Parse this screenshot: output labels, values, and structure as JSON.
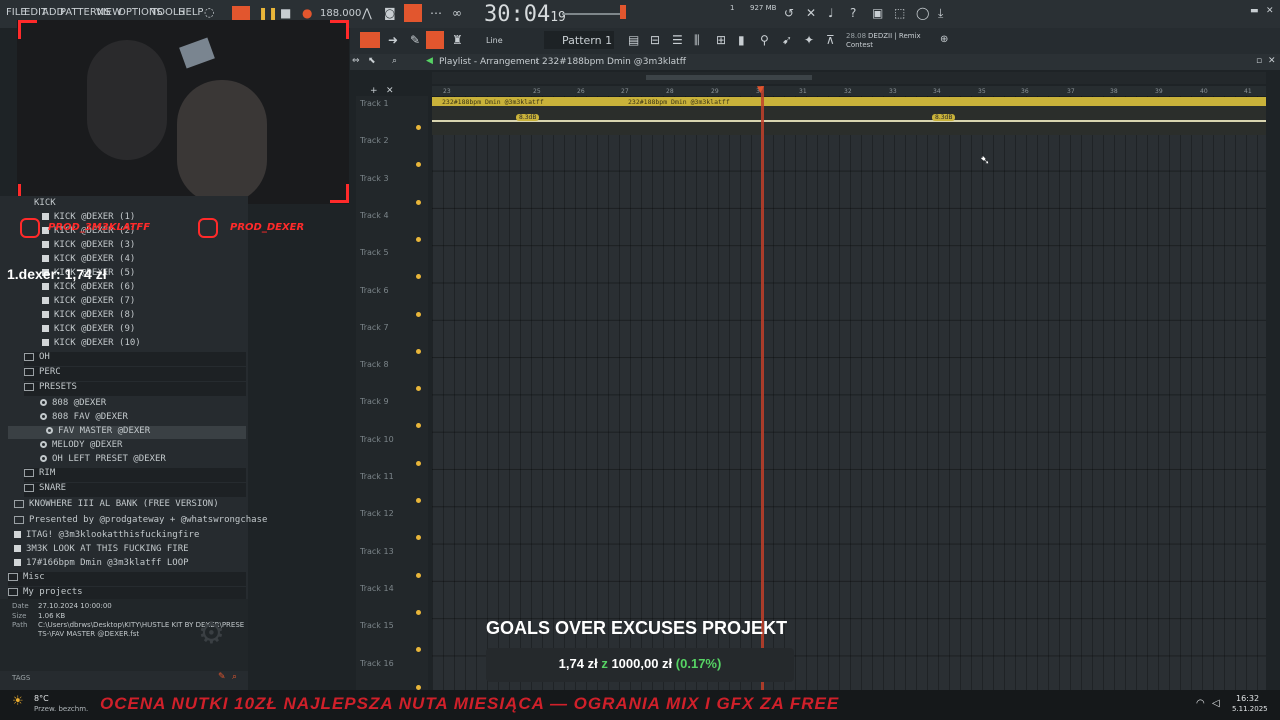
{
  "menu": {
    "items": [
      "FILE",
      "EDIT",
      "ADD",
      "PATTERNS",
      "VIEW",
      "OPTIONS",
      "TOOLS",
      "HELP"
    ]
  },
  "transport": {
    "time_main": "30:04",
    "time_sub": "19",
    "bpm": "188.000",
    "memory": "927 MB",
    "cpu": "1"
  },
  "toolbar": {
    "snap": "Line",
    "pattern": "Pattern 1",
    "news_date": "28.08",
    "news_text": "DEDZII | Remix Contest"
  },
  "playlist": {
    "title": "Playlist - Arrangement",
    "breadcrumb": "232#188bpm Dmin @3m3klatff",
    "ruler": [
      "23",
      "25",
      "26",
      "27",
      "28",
      "29",
      "30",
      "31",
      "32",
      "33",
      "34",
      "35",
      "36",
      "37",
      "38",
      "39",
      "40",
      "41"
    ],
    "tracks": [
      "Track 1",
      "Track 2",
      "Track 3",
      "Track 4",
      "Track 5",
      "Track 6",
      "Track 7",
      "Track 8",
      "Track 9",
      "Track 10",
      "Track 11",
      "Track 12",
      "Track 13",
      "Track 14",
      "Track 15",
      "Track 16"
    ],
    "clips": [
      "232#188bpm Dmin @3m3klatff",
      "232#188bpm Dmin @3m3klatff"
    ],
    "db_tags": [
      "8.3dB",
      "8.3dB"
    ]
  },
  "browser": {
    "kick_folder": "KICK",
    "kicks": [
      "KICK @DEXER (1)",
      "KICK @DEXER (2)",
      "KICK @DEXER (3)",
      "KICK @DEXER (4)",
      "KICK @DEXER (5)",
      "KICK @DEXER (6)",
      "KICK @DEXER (7)",
      "KICK @DEXER (8)",
      "KICK @DEXER (9)",
      "KICK @DEXER (10)"
    ],
    "folders": [
      "OH",
      "PERC",
      "PRESETS"
    ],
    "presets": [
      "808 @DEXER",
      "808 FAV @DEXER",
      "FAV MASTER @DEXER",
      "MELODY @DEXER",
      "OH LEFT PRESET @DEXER"
    ],
    "folders2": [
      "RIM",
      "SNARE"
    ],
    "packs": [
      "KNOWHERE III AL BANK (FREE VERSION)",
      "Presented by @prodgateway + @whatswrongchase"
    ],
    "files": [
      "ITAG! @3m3klookatthisfuckingfire",
      "3M3K LOOK AT THIS FUCKING FIRE",
      "17#166bpm Dmin @3m3klatff LOOP"
    ],
    "root": [
      "Misc",
      "My projects"
    ],
    "info": {
      "date_label": "Date",
      "date": "27.10.2024 10:00:00",
      "size_label": "Size",
      "size": "1.06 KB",
      "path_label": "Path",
      "path": "C:\\Users\\dbrws\\Desktop\\KITY\\HUSTLE KIT BY DEXER\\PRESETS-\\FAV MASTER @DEXER.fst"
    },
    "tags": "TAGS"
  },
  "overlay": {
    "leader": "1.dexer: 1,74 zł",
    "social1": "PROD_3M3KLATFF",
    "social2": "PROD_DEXER",
    "goal_title": "GOALS OVER EXCUSES PROJEKT",
    "goal_current": "1,74 zł",
    "goal_sep": "z",
    "goal_target": "1000,00 zł",
    "goal_pct": "(0.17%)",
    "ticker": "OCENA NUTKI 10ZŁ   NAJLEPSZA NUTA MIESIĄCA — OGRANIA MIX I GFX ZA FREE"
  },
  "taskbar": {
    "weather_temp": "8°C",
    "weather_desc": "Przew. bezchm.",
    "clock": "16:32",
    "date": "5.11.2025"
  },
  "colors": {
    "accent": "#e9b63a",
    "playhead": "#c2402a",
    "overlay_red": "#ff2a2a",
    "goal_green": "#56d364"
  }
}
